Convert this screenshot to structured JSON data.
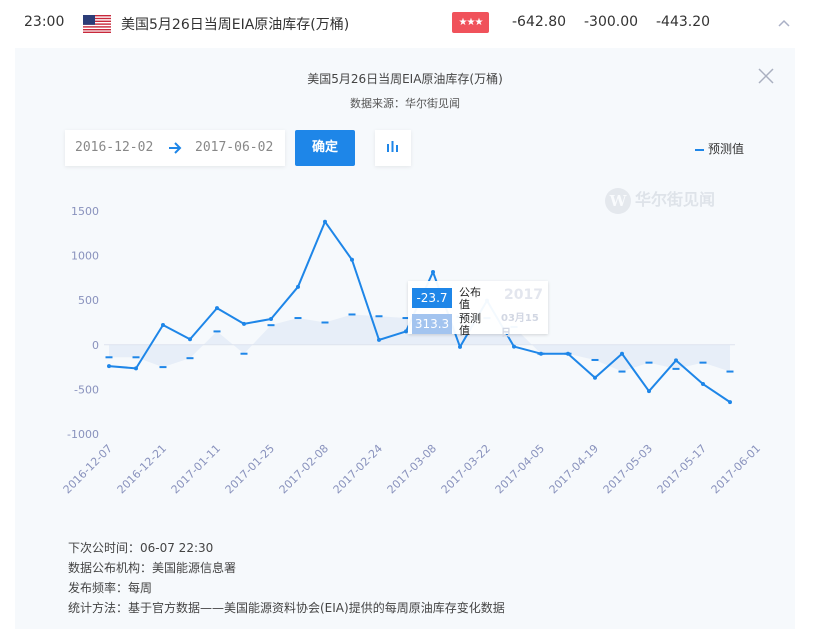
{
  "event": {
    "time": "23:00",
    "title": "美国5月26日当周EIA原油库存(万桶)",
    "importance_stars": "★★★",
    "actual": "-642.80",
    "forecast": "-300.00",
    "previous": "-443.20"
  },
  "panel": {
    "title": "美国5月26日当周EIA原油库存(万桶)",
    "source": "数据来源：华尔街见闻",
    "date_start": "2016-12-02",
    "date_end": "2017-06-02",
    "confirm_label": "确定",
    "legend_label": "预测值",
    "watermark_text": "华尔街见闻",
    "watermark_letter": "W"
  },
  "tooltip": {
    "actual_value": "-23.7",
    "actual_label": "公布值",
    "forecast_value": "313.3",
    "forecast_label": "预测值",
    "year": "2017",
    "date": "03月15日"
  },
  "info": {
    "next_release": "下次公时间：06-07 22:30",
    "publisher": "数据公布机构：美国能源信息署",
    "frequency": "发布频率：每周",
    "method": "统计方法：基于官方数据——美国能源资料协会(EIA)提供的每周原油库存变化数据"
  },
  "colors": {
    "accent": "#1e86e8",
    "star_badge": "#f0525b",
    "tooltip_forecast": "#a3c4ef",
    "area_fill": "#e4ecf7",
    "axis_text": "#8992bd"
  },
  "chart_data": {
    "type": "line",
    "y_ticks": [
      1500,
      1000,
      500,
      0,
      -500,
      -1000
    ],
    "ylim": [
      -1000,
      1500
    ],
    "x_tick_labels": [
      "2016-12-07",
      "2016-12-21",
      "2017-01-11",
      "2017-01-25",
      "2017-02-08",
      "2017-02-24",
      "2017-03-08",
      "2017-03-22",
      "2017-04-05",
      "2017-04-19",
      "2017-05-03",
      "2017-05-17",
      "2017-06-01"
    ],
    "series": [
      {
        "name": "公布值",
        "values": [
          -239,
          -264,
          222,
          62,
          411,
          235,
          289,
          650,
          1380,
          953,
          55,
          150,
          816,
          -23.7,
          495,
          -20,
          -100,
          -100,
          -370,
          -100,
          -520,
          -175,
          -440,
          -642.8
        ]
      },
      {
        "name": "预测值",
        "values": [
          -140,
          -140,
          -250,
          -150,
          150,
          -100,
          220,
          300,
          250,
          340,
          320,
          300,
          200,
          313.3,
          300,
          200,
          -100,
          -100,
          -170,
          -300,
          -200,
          -270,
          -200,
          -300
        ]
      }
    ]
  }
}
